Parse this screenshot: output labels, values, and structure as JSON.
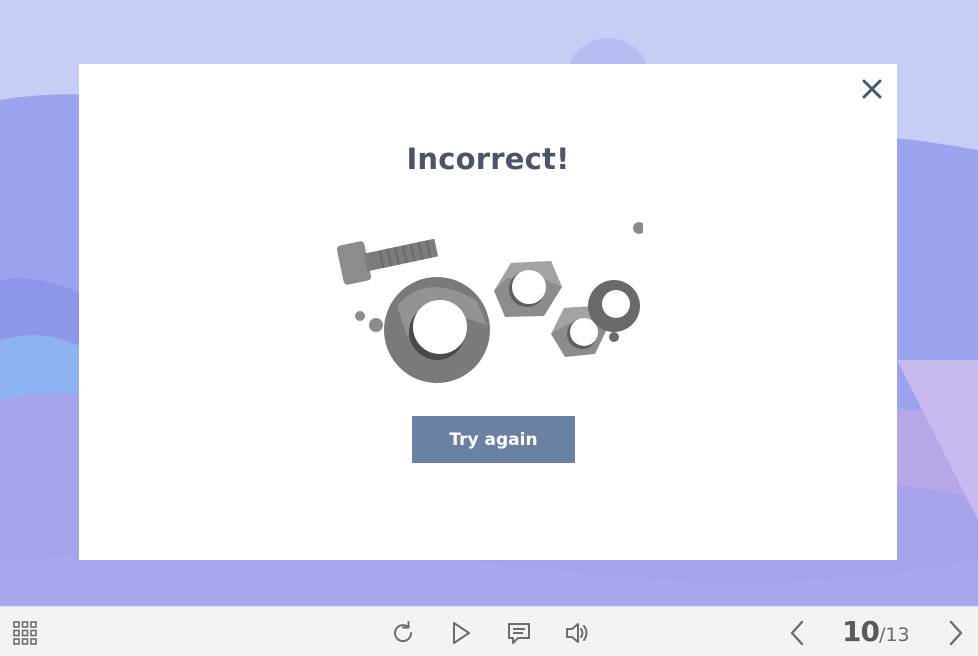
{
  "modal": {
    "title": "Incorrect!",
    "button_label": "Try again",
    "close_icon": "close-icon",
    "illustration": "nuts-and-bolts-illustration"
  },
  "toolbar": {
    "left_icon": "grid-menu-icon",
    "center_icons": [
      "replay-icon",
      "play-icon",
      "notes-icon",
      "volume-icon"
    ],
    "nav": {
      "prev_icon": "chevron-left-icon",
      "next_icon": "chevron-right-icon",
      "current": "10",
      "separator": "/",
      "total": "13"
    }
  },
  "colors": {
    "background": "#c7ccf4",
    "modal": "#ffffff",
    "title_text": "#4a5668",
    "button": "#6a81a4",
    "toolbar": "#f3f3f3"
  }
}
